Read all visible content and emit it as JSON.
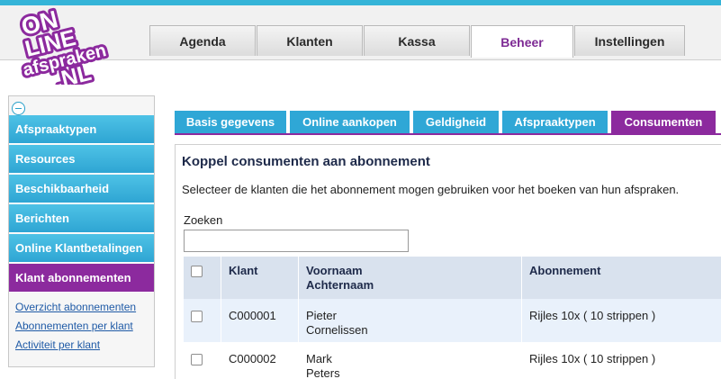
{
  "logo": {
    "line1": "ON",
    "line2": "LINE",
    "line3": "afspraken",
    "line4": ".NL"
  },
  "main_tabs": [
    {
      "label": "Agenda",
      "active": false
    },
    {
      "label": "Klanten",
      "active": false
    },
    {
      "label": "Kassa",
      "active": false
    },
    {
      "label": "Beheer",
      "active": true
    },
    {
      "label": "Instellingen",
      "active": false
    }
  ],
  "sidebar": {
    "items": [
      {
        "label": "Afspraaktypen",
        "active": false
      },
      {
        "label": "Resources",
        "active": false
      },
      {
        "label": "Beschikbaarheid",
        "active": false
      },
      {
        "label": "Berichten",
        "active": false
      },
      {
        "label": "Online Klantbetalingen",
        "active": false
      },
      {
        "label": "Klant abonnementen",
        "active": true
      }
    ],
    "sublinks": [
      {
        "label": "Overzicht abonnementen"
      },
      {
        "label": "Abonnementen per klant"
      },
      {
        "label": "Activiteit per klant"
      }
    ]
  },
  "sub_tabs": [
    {
      "label": "Basis gegevens",
      "active": false
    },
    {
      "label": "Online aankopen",
      "active": false
    },
    {
      "label": "Geldigheid",
      "active": false
    },
    {
      "label": "Afspraaktypen",
      "active": false
    },
    {
      "label": "Consumenten",
      "active": true
    }
  ],
  "content": {
    "title": "Koppel consumenten aan abonnement",
    "description": "Selecteer de klanten die het abonnement mogen gebruiken voor het boeken van hun afspraken.",
    "search_label": "Zoeken",
    "search_value": ""
  },
  "table": {
    "headers": {
      "klant": "Klant",
      "voornaam": "Voornaam",
      "achternaam": "Achternaam",
      "abonnement": "Abonnement"
    },
    "rows": [
      {
        "klant": "C000001",
        "voornaam": "Pieter",
        "achternaam": "Cornelissen",
        "abonnement": "Rijles 10x ( 10 strippen )",
        "checked": false
      },
      {
        "klant": "C000002",
        "voornaam": "Mark",
        "achternaam": "Peters",
        "abonnement": "Rijles 10x ( 10 strippen )",
        "checked": false
      }
    ]
  },
  "colors": {
    "accent_blue": "#2fa7d6",
    "accent_purple": "#8c2a9e",
    "top_stripe": "#35b4d8"
  }
}
